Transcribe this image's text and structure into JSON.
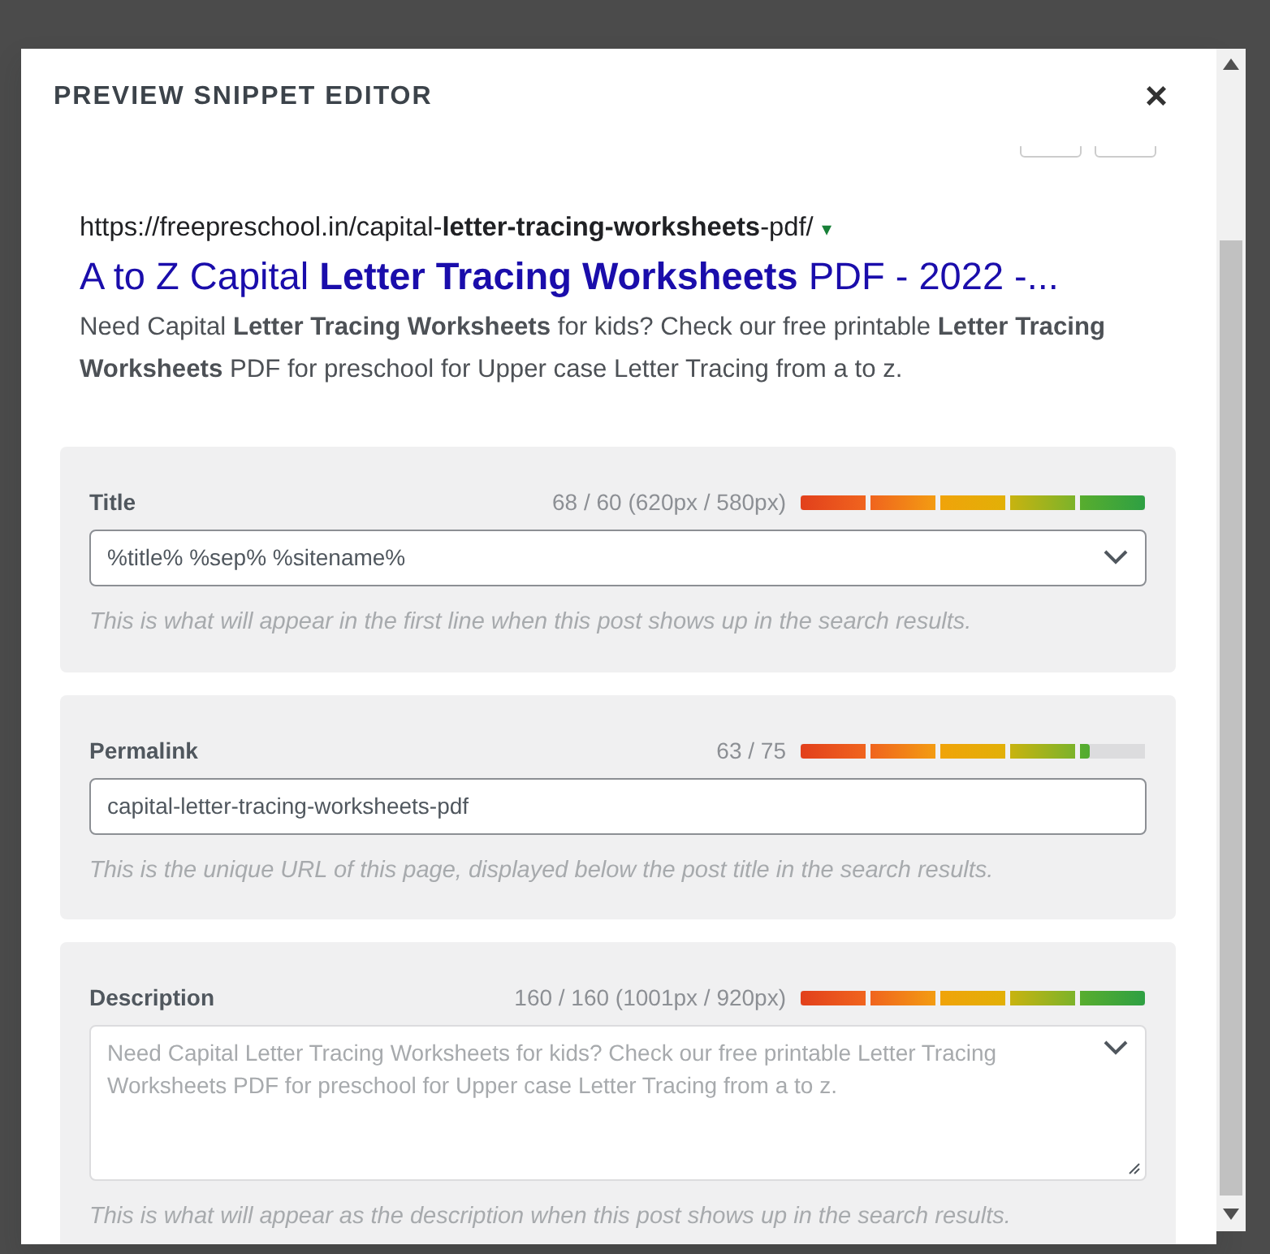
{
  "modal": {
    "title": "PREVIEW SNIPPET EDITOR",
    "close": "×"
  },
  "preview": {
    "url": "https://freepreschool.in/capital-**letter-tracing-worksheets**-pdf/",
    "url_caret": "▾",
    "title": "A to Z Capital **Letter Tracing Worksheets** PDF - 2022 -...",
    "snippet": "Need Capital **Letter Tracing Worksheets** for kids? Check our free printable **Letter Tracing Worksheets** PDF for preschool for Upper case Letter Tracing from a to z."
  },
  "fields": [
    {
      "kind": "select",
      "label": "Title",
      "count": "68 / 60 (620px / 580px)",
      "level": 1,
      "value": "%title% %sep% %sitename%",
      "hint": "This is what will appear in the first line when this post shows up in the search results."
    },
    {
      "kind": "text",
      "label": "Permalink",
      "count": "63 / 75",
      "level": 0.84,
      "value": "capital-letter-tracing-worksheets-pdf",
      "hint": "This is the unique URL of this page, displayed below the post title in the search results."
    },
    {
      "kind": "textarea",
      "label": "Description",
      "count": "160 / 160 (1001px / 920px)",
      "level": 1,
      "placeholder": "Need Capital Letter Tracing Worksheets for kids? Check our free printable Letter Tracing Worksheets PDF for preschool for Upper case Letter Tracing from a to z.",
      "hint": "This is what will appear as the description when this post shows up in the search results."
    }
  ]
}
